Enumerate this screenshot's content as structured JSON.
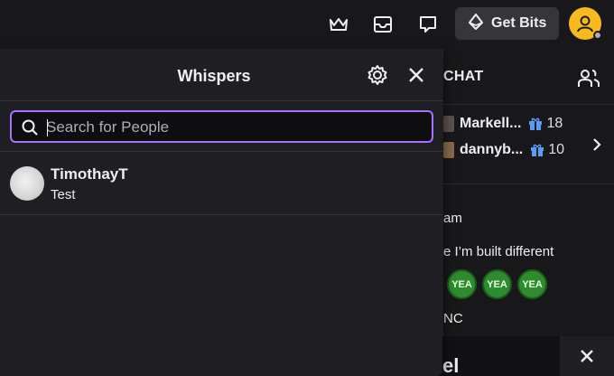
{
  "topbar": {
    "icons": [
      "crown-icon",
      "inbox-icon",
      "whispers-icon"
    ],
    "get_bits_label": "Get Bits"
  },
  "chat": {
    "title": "CHAT",
    "gifters": [
      {
        "name": "Markell...",
        "count": "18"
      },
      {
        "name": "dannyb...",
        "count": "10"
      }
    ],
    "lines": [
      "am",
      "e I’m built different",
      "NC"
    ],
    "emotes": [
      "YEA",
      "YEA",
      "YEA"
    ],
    "strip_text": "el"
  },
  "whispers": {
    "title": "Whispers",
    "search_placeholder": "Search for People",
    "search_value": "",
    "threads": [
      {
        "name": "TimothayT",
        "last_message": "Test"
      }
    ]
  },
  "colors": {
    "accent": "#a970ff",
    "avatar_bg": "#f7b91e",
    "panel_bg": "#1f1f23",
    "page_bg": "#18181b",
    "gift": "#5b9bf6",
    "emote": "#2e8b2e"
  }
}
